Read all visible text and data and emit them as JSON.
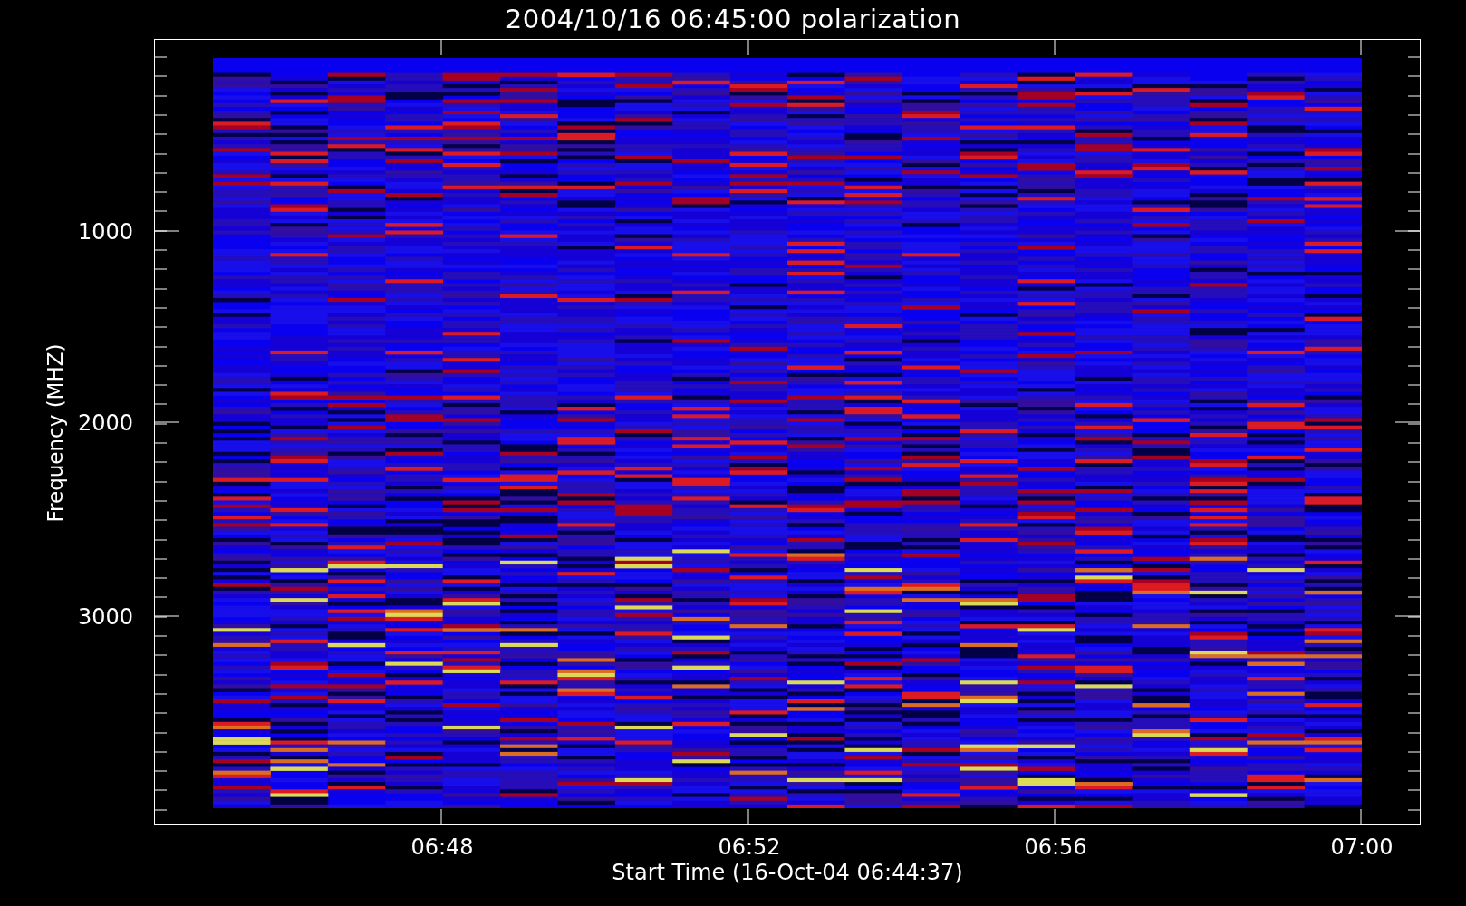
{
  "title": "2004/10/16 06:45:00 polarization",
  "y_axis": {
    "label": "Frequency (MHZ)",
    "ticks": [
      "1000",
      "2000",
      "3000"
    ]
  },
  "x_axis": {
    "label": "Start Time (16-Oct-04 06:44:37)",
    "ticks": [
      "06:48",
      "06:52",
      "06:56",
      "07:00"
    ]
  }
}
